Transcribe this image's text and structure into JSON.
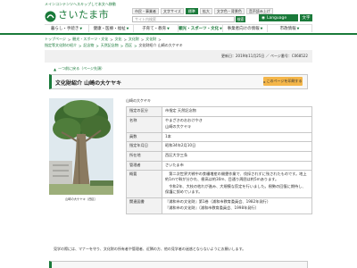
{
  "header": {
    "skip_link": "メインコンテンツへスキップして本文へ移動",
    "logo_text": "さいたま市",
    "utility": [
      {
        "label": "市民・事業者",
        "icon": "person-icon"
      },
      {
        "label": "文字サイズ",
        "icon": "text-size-icon"
      },
      {
        "label": "標準",
        "icon": ""
      },
      {
        "label": "拡大",
        "icon": ""
      },
      {
        "label": "文字色・背景色",
        "icon": "color-icon"
      },
      {
        "label": "音声読み上げ",
        "icon": "speaker-icon"
      }
    ],
    "search_placeholder": "サイト内検索",
    "search_button": "検索",
    "language_button": "Language",
    "large_text_button": "文字"
  },
  "global_nav": [
    {
      "label": "暮らし・手続き"
    },
    {
      "label": "健康・医療・福祉"
    },
    {
      "label": "子育て・教育"
    },
    {
      "label": "観光・スポーツ・文化"
    },
    {
      "label": "事業者向けの情報"
    },
    {
      "label": "市政情報"
    }
  ],
  "breadcrumbs": {
    "row1": [
      "トップページ",
      "観光・スポーツ・文化",
      "文化",
      "文化財",
      "文化財"
    ],
    "row2": [
      "指定等文化財の紹介",
      "記念物",
      "天然記念物",
      "西区"
    ],
    "current": "文化財紹介 山崎の大ケヤキ"
  },
  "page_meta": {
    "page_id": "更新日：2019年11月25日 ／ ページ番号：C068522"
  },
  "back_link": "一つ前に戻る（ページ先頭）",
  "title": "文化財紹介 山崎の大ケヤキ",
  "detail_button": "このページを印刷する",
  "photo": {
    "caption": "山崎の大ケヤキ（西区）"
  },
  "name_label": "山崎の大ケヤキ",
  "info_rows": [
    {
      "label": "指定の区分",
      "value": [
        "市指定 天然記念物"
      ]
    },
    {
      "label": "名称",
      "value": [
        "やまざきのおおけやき",
        "山崎の大ケヤキ"
      ]
    },
    {
      "label": "員数",
      "value": [
        "1本"
      ]
    },
    {
      "label": "指定年月日",
      "value": [
        "昭和34年2月10日"
      ]
    },
    {
      "label": "所在地",
      "value": [
        "西区大字三条"
      ]
    },
    {
      "label": "管理者",
      "value": [
        "さいたま市"
      ]
    },
    {
      "label": "概要",
      "value": [
        "　第二次世界大戦中の食糧増産の開墾作業で、伐採されずに残されたものです。地上約1mで幹が分かれ、樹高は約30m、目通り周囲は約5mあります。",
        "　令和2年、大枝の枯れが進み、大規模な剪定を行いました。樹勢の回復に期待し、保護に努めています。"
      ]
    },
    {
      "label": "関連図書",
      "value": [
        "『浦和市の文化財』第1巻（浦和市教育委員会、1982年発行）",
        "『浦和市の文化財』（浦和市教育委員会、1998年発行）"
      ]
    }
  ],
  "footnote": "見学の際には、マナーを守り、文化財の所有者や管理者、近隣の方、他の見学者の迷惑とならないようにお願いします。",
  "colors": {
    "brand_green": "#1a7a3a",
    "accent_orange": "#f4b64a"
  }
}
